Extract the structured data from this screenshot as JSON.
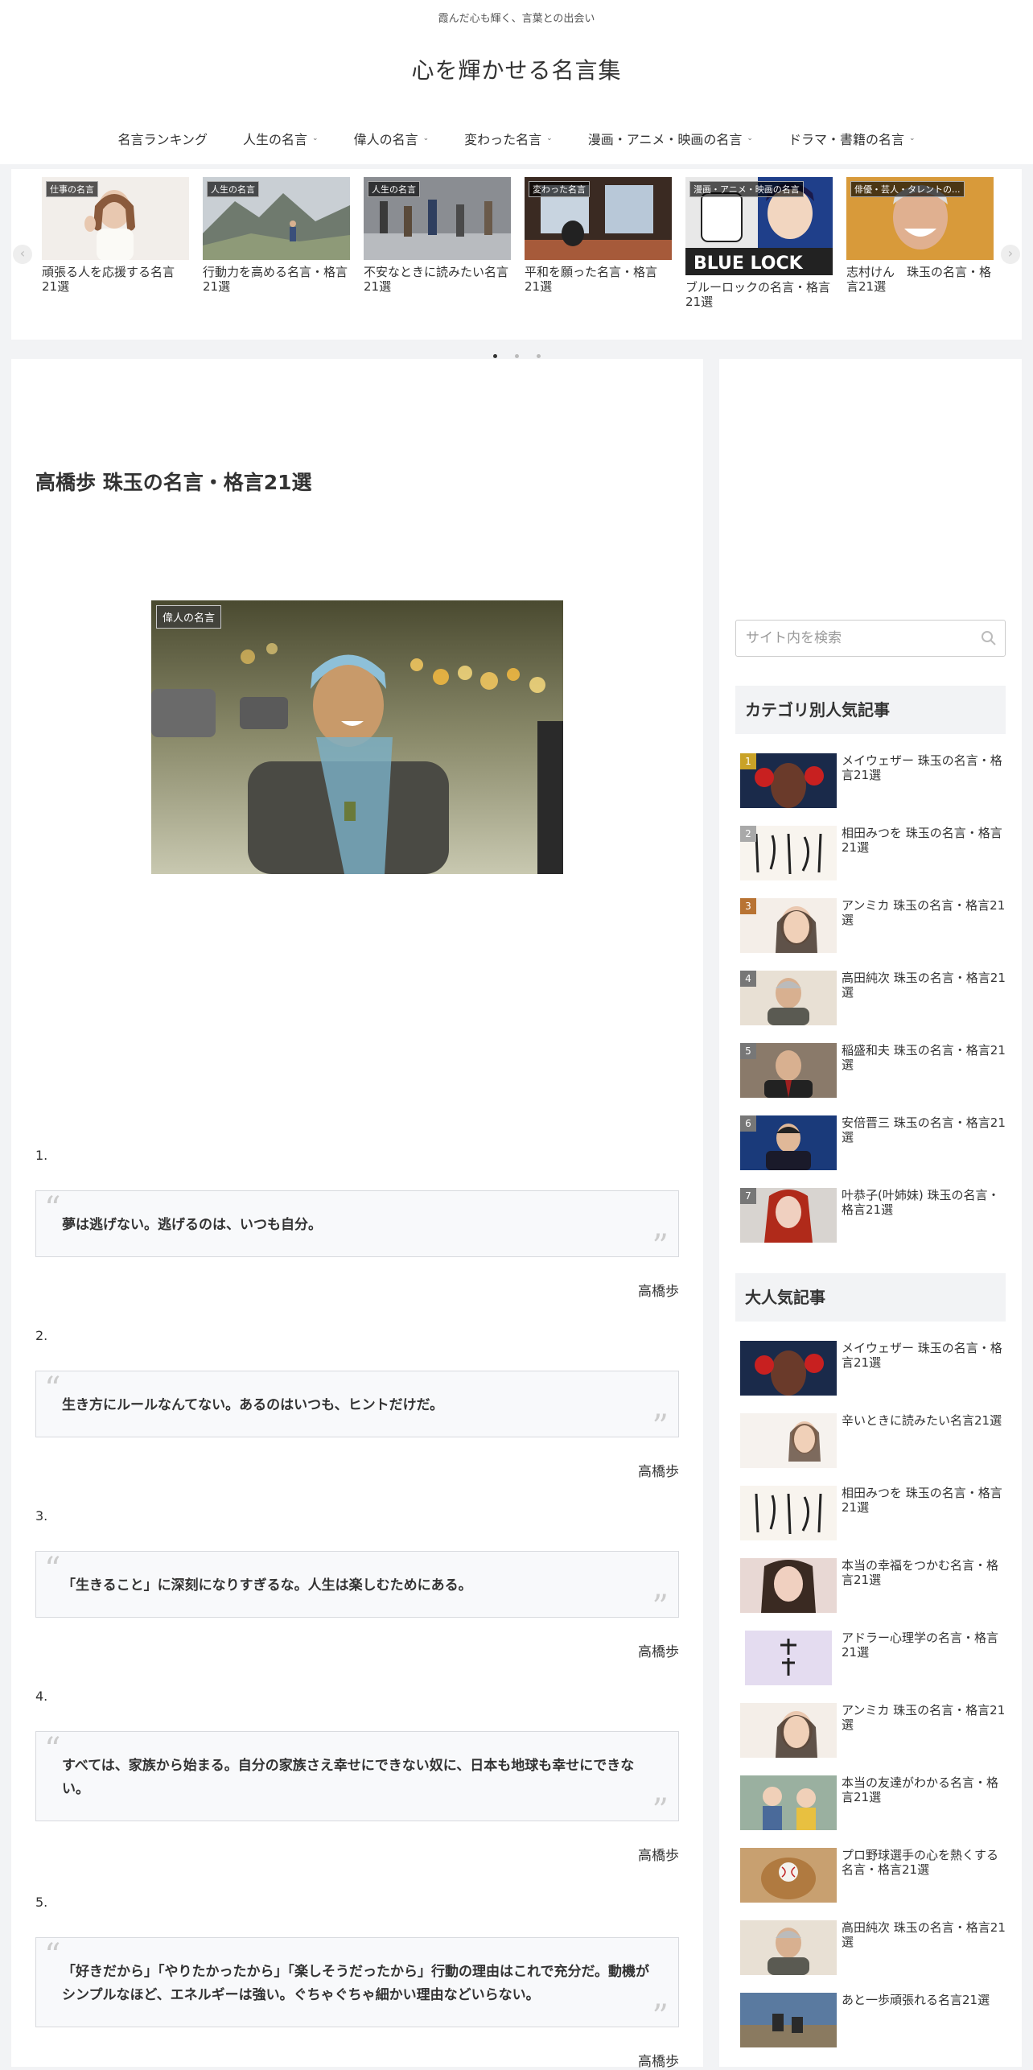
{
  "header": {
    "tagline": "霞んだ心も輝く、言葉との出会い",
    "site_title": "心を輝かせる名言集",
    "nav": [
      {
        "label": "名言ランキング",
        "has_dropdown": false
      },
      {
        "label": "人生の名言",
        "has_dropdown": true
      },
      {
        "label": "偉人の名言",
        "has_dropdown": true
      },
      {
        "label": "変わった名言",
        "has_dropdown": true
      },
      {
        "label": "漫画・アニメ・映画の名言",
        "has_dropdown": true
      },
      {
        "label": "ドラマ・書籍の名言",
        "has_dropdown": true
      }
    ]
  },
  "carousel": {
    "items": [
      {
        "tag": "仕事の名言",
        "title": "頑張る人を応援する名言21選"
      },
      {
        "tag": "人生の名言",
        "title": "行動力を高める名言・格言21選"
      },
      {
        "tag": "人生の名言",
        "title": "不安なときに読みたい名言21選"
      },
      {
        "tag": "変わった名言",
        "title": "平和を願った名言・格言21選"
      },
      {
        "tag": "漫画・アニメ・映画の名言",
        "title": "ブルーロックの名言・格言21選"
      },
      {
        "tag": "俳優・芸人・タレントの...",
        "title": "志村けん　珠玉の名言・格言21選"
      }
    ],
    "active_page": 1,
    "page_count": 3
  },
  "article": {
    "title": "高橋歩 珠玉の名言・格言21選",
    "eyecatch_tag": "偉人の名言",
    "quotes": [
      {
        "num": "1.",
        "text": "夢は逃げない。逃げるのは、いつも自分。",
        "author": "高橋歩"
      },
      {
        "num": "2.",
        "text": "生き方にルールなんてない。あるのはいつも、ヒントだけだ。",
        "author": "高橋歩"
      },
      {
        "num": "3.",
        "text": "「生きること」に深刻になりすぎるな。人生は楽しむためにある。",
        "author": "高橋歩"
      },
      {
        "num": "4.",
        "text": "すべては、家族から始まる。自分の家族さえ幸せにできない奴に、日本も地球も幸せにできない。",
        "author": "高橋歩"
      },
      {
        "num": "5.",
        "text": "「好きだから」「やりたかったから」「楽しそうだったから」行動の理由はこれで充分だ。動機がシンプルなほど、エネルギーは強い。ぐちゃぐちゃ細かい理由などいらない。",
        "author": "高橋歩"
      }
    ]
  },
  "sidebar": {
    "search_placeholder": "サイト内を検索",
    "category_title": "カテゴリ別人気記事",
    "category_items": [
      {
        "rank": "1",
        "title": "メイウェザー 珠玉の名言・格言21選"
      },
      {
        "rank": "2",
        "title": "相田みつを 珠玉の名言・格言21選"
      },
      {
        "rank": "3",
        "title": "アンミカ 珠玉の名言・格言21選"
      },
      {
        "rank": "4",
        "title": "高田純次 珠玉の名言・格言21選"
      },
      {
        "rank": "5",
        "title": "稲盛和夫 珠玉の名言・格言21選"
      },
      {
        "rank": "6",
        "title": "安倍晋三 珠玉の名言・格言21選"
      },
      {
        "rank": "7",
        "title": "叶恭子(叶姉妹) 珠玉の名言・格言21選"
      }
    ],
    "popular_title": "大人気記事",
    "popular_items": [
      {
        "title": "メイウェザー 珠玉の名言・格言21選"
      },
      {
        "title": "辛いときに読みたい名言21選"
      },
      {
        "title": "相田みつを 珠玉の名言・格言21選"
      },
      {
        "title": "本当の幸福をつかむ名言・格言21選"
      },
      {
        "title": "アドラー心理学の名言・格言21選"
      },
      {
        "title": "アンミカ 珠玉の名言・格言21選"
      },
      {
        "title": "本当の友達がわかる名言・格言21選"
      },
      {
        "title": "プロ野球選手の心を熱くする名言・格言21選"
      },
      {
        "title": "高田純次 珠玉の名言・格言21選"
      },
      {
        "title": "あと一歩頑張れる名言21選"
      }
    ]
  },
  "colors": {
    "rank_1": "#c9a227",
    "rank_2": "#a9a9a9",
    "rank_3": "#b87333",
    "rank_other": "#777777"
  }
}
